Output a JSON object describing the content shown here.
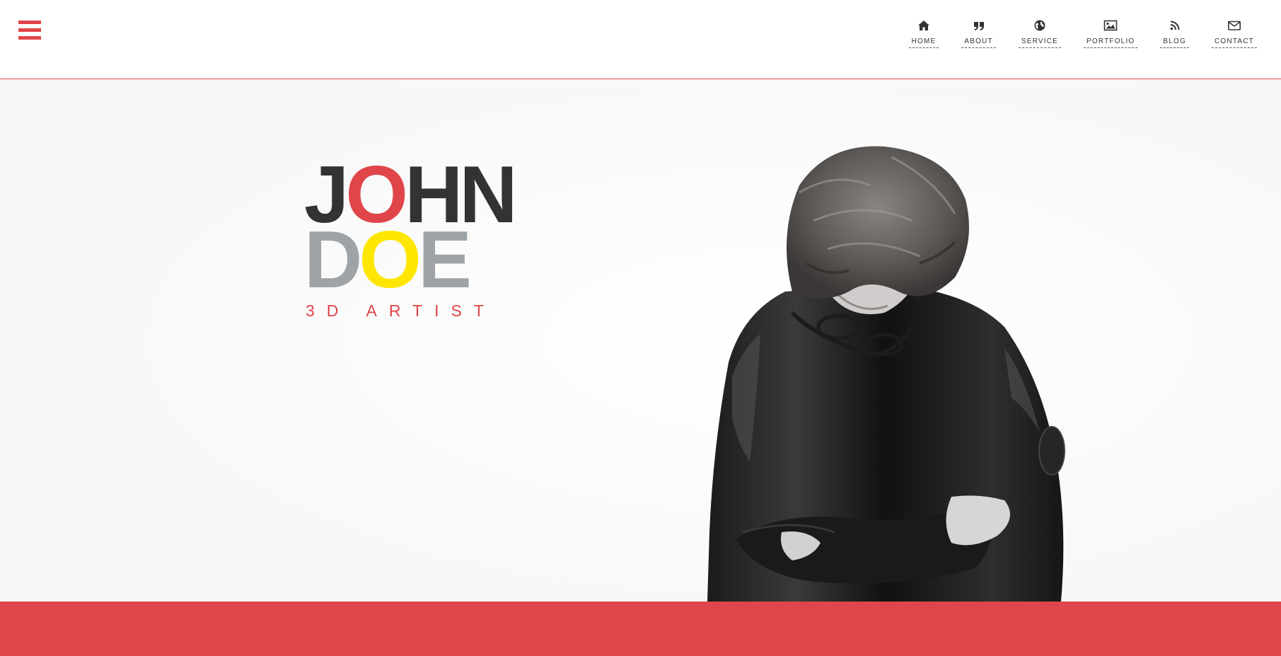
{
  "colors": {
    "accent": "#e0454a",
    "dark": "#333333",
    "grey": "#9ea3a8",
    "yellow": "#ffe600"
  },
  "header": {
    "menu_icon": "hamburger-menu-icon",
    "nav": [
      {
        "label": "HOME",
        "icon": "home-icon"
      },
      {
        "label": "ABOUT",
        "icon": "quote-icon"
      },
      {
        "label": "SERVICE",
        "icon": "globe-icon"
      },
      {
        "label": "PORTFOLIO",
        "icon": "image-icon"
      },
      {
        "label": "BLOG",
        "icon": "rss-icon"
      },
      {
        "label": "CONTACT",
        "icon": "envelope-icon"
      }
    ]
  },
  "hero": {
    "first_name_letters": [
      "J",
      "O",
      "H",
      "N"
    ],
    "last_name_letters": [
      "D",
      "O",
      "E"
    ],
    "subtitle": "3D ARTIST",
    "photo": "black-and-white-portrait-of-man-looking-down"
  }
}
